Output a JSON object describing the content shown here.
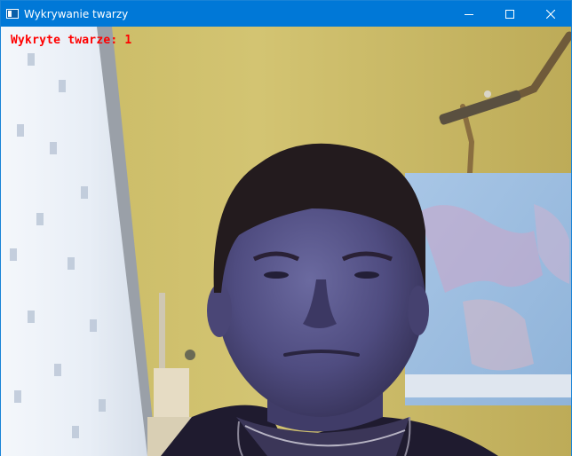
{
  "window": {
    "title": "Wykrywanie twarzy",
    "icons": {
      "app": "app-window-icon",
      "minimize": "minimize-icon",
      "maximize": "maximize-icon",
      "close": "close-icon"
    }
  },
  "overlay": {
    "detected_label": "Wykryte twarze: 1",
    "color": "#ff0000"
  },
  "colors": {
    "titlebar": "#0078d7",
    "wall": "#cdbf6a"
  }
}
